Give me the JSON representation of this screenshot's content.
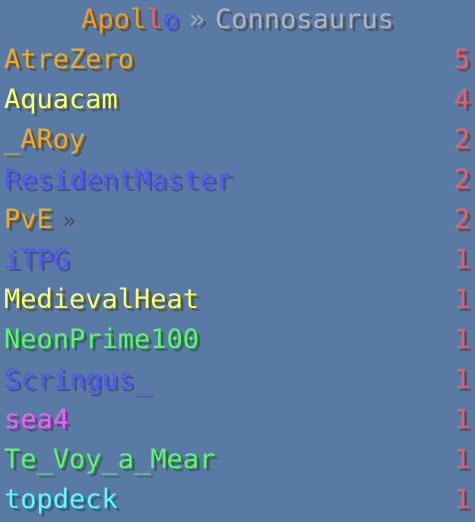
{
  "title": {
    "letters": [
      {
        "ch": "A",
        "color": "#ff9900"
      },
      {
        "ch": "p",
        "color": "#ff9900"
      },
      {
        "ch": "o",
        "color": "#ff9900"
      },
      {
        "ch": "l",
        "color": "#ff9900"
      },
      {
        "ch": "l",
        "color": "#ff5555"
      },
      {
        "ch": "o",
        "color": "#5555ff"
      }
    ],
    "separator": "»",
    "separator_color": "#9aa7b8",
    "server": "Connosaurus",
    "server_color": "#b4b4b4"
  },
  "rows": [
    {
      "name": "AtreZero",
      "color": "#ffaa00",
      "score": "5"
    },
    {
      "name": "Aquacam",
      "color": "#ffff55",
      "score": "4"
    },
    {
      "name": "_ARoy",
      "color": "#ffaa00",
      "score": "2"
    },
    {
      "name": "ResidentMaster",
      "color": "#5555ff",
      "score": "2"
    },
    {
      "name": "PvE",
      "color": "#ffaa00",
      "score": "2",
      "suffix": "»"
    },
    {
      "name": "iTPG",
      "color": "#5555ff",
      "score": "1"
    },
    {
      "name": "MedievalHeat",
      "color": "#ffff55",
      "score": "1"
    },
    {
      "name": "NeonPrime100",
      "color": "#55ff55",
      "score": "1"
    },
    {
      "name": "Scringus_",
      "color": "#5555ff",
      "score": "1"
    },
    {
      "name": "sea4",
      "color": "#ff55ff",
      "score": "1"
    },
    {
      "name": "Te_Voy_a_Mear",
      "color": "#55ff55",
      "score": "1"
    },
    {
      "name": "topdeck",
      "color": "#55ffff",
      "score": "1"
    }
  ]
}
